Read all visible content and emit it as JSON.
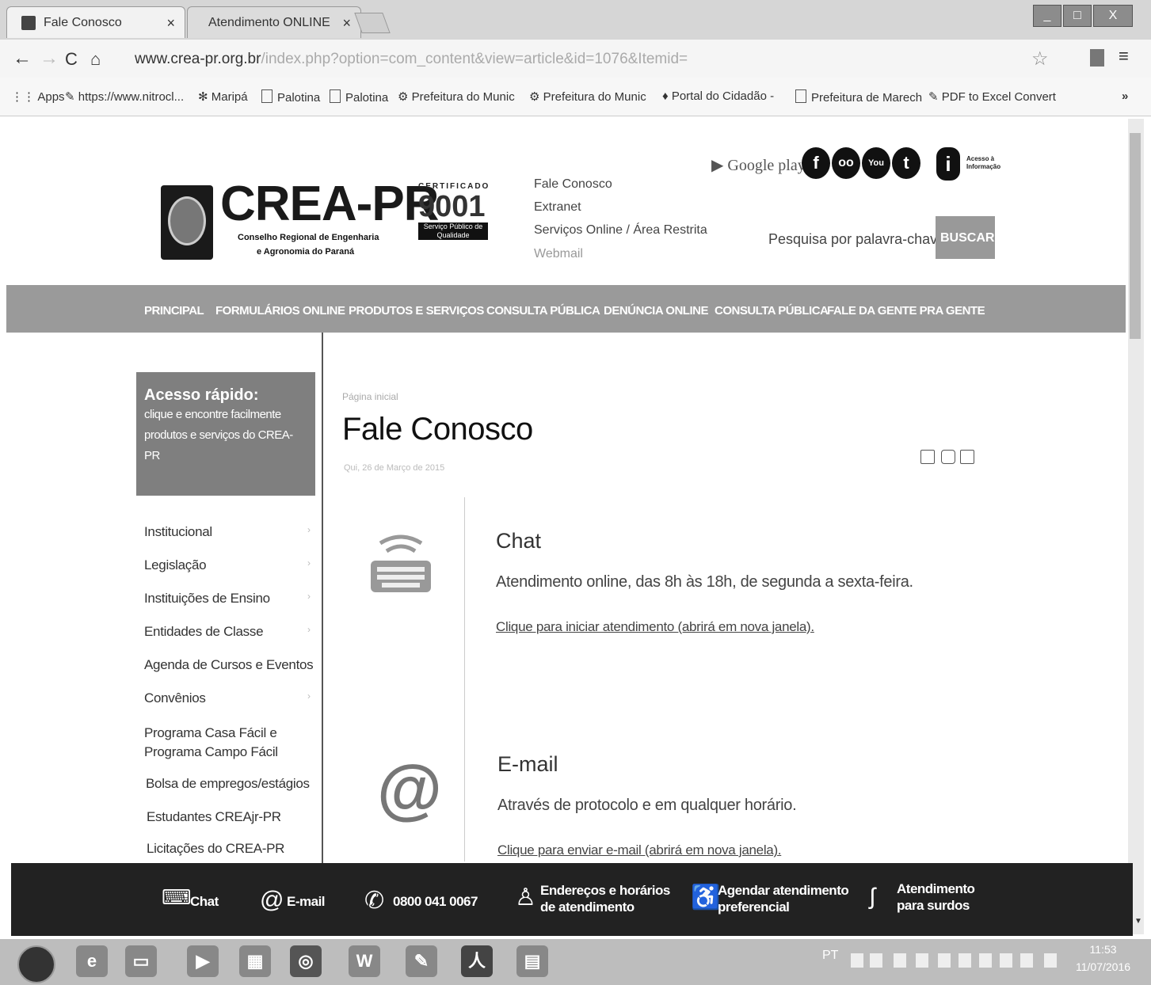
{
  "browser": {
    "tabs": [
      {
        "label": "Fale Conosco",
        "close": "×"
      },
      {
        "label": "Atendimento ONLINE",
        "close": "×"
      }
    ],
    "window_buttons": [
      "_",
      "□",
      "X"
    ],
    "url_host": "www.crea-pr.org.br",
    "url_rest": "/index.php?option=com_content&view=article&id=1076&Itemid=",
    "bookmarks": [
      "Apps",
      "https://www.nitrocl...",
      "Maripá",
      "Palotina",
      "Palotina",
      "Prefeitura do Munic",
      "Prefeitura do Munic",
      "Portal do Cidadão - ",
      "Prefeitura de Marech",
      "PDF to Excel Convert"
    ],
    "bookmarks_more": "»"
  },
  "header": {
    "logo_text": "CREA-PR",
    "logo_sub1": "Conselho Regional de Engenharia",
    "logo_sub2": "e Agronomia do Paraná",
    "iso_cert": "CERTIFICADO",
    "iso_num": "9001",
    "iso_band": "Serviço Público de Qualidade",
    "top_links": [
      "Fale Conosco",
      "Extranet",
      "Serviços Online / Área Restrita",
      "Webmail"
    ],
    "google_play": "Google play",
    "social": [
      "f",
      "oo",
      "You",
      "t"
    ],
    "info_icon": "i",
    "info_text1": "Acesso à",
    "info_text2": "Informação",
    "search_label": "Pesquisa por palavra-chave",
    "search_button": "BUSCAR"
  },
  "nav": {
    "items": [
      "PRINCIPAL",
      "FORMULÁRIOS ONLINE",
      "PRODUTOS E SERVIÇOS",
      "CONSULTA PÚBLICA",
      "DENÚNCIA ONLINE",
      "CONSULTA PÚBLICA",
      "FALE DA GENTE PRA GENTE"
    ]
  },
  "sidebar": {
    "quick_title": "Acesso rápido:",
    "quick_sub": "clique e encontre facilmente produtos e serviços do CREA-PR",
    "items": [
      {
        "label": "Institucional",
        "arrow": "›"
      },
      {
        "label": "Legislação",
        "arrow": "›"
      },
      {
        "label": "Instituições de Ensino",
        "arrow": "›"
      },
      {
        "label": "Entidades de Classe",
        "arrow": "›"
      },
      {
        "label": "Agenda de Cursos e Eventos",
        "arrow": ""
      },
      {
        "label": "Convênios",
        "arrow": "›"
      },
      {
        "label": "Programa Casa Fácil e",
        "label2": "Programa Campo Fácil",
        "arrow": ""
      },
      {
        "label": "Bolsa de empregos/estágios",
        "arrow": ""
      },
      {
        "label": "Estudantes CREAjr-PR",
        "arrow": ""
      },
      {
        "label": "Licitações do CREA-PR",
        "arrow": ""
      }
    ]
  },
  "main": {
    "breadcrumb": "Página inicial",
    "title": "Fale Conosco",
    "date": "Qui, 26 de Março de 2015",
    "chat": {
      "title": "Chat",
      "text": "Atendimento online, das 8h às 18h, de segunda a sexta-feira.",
      "link": "Clique para iniciar atendimento (abrirá em nova janela)."
    },
    "email": {
      "icon": "@",
      "title": "E-mail",
      "text": "Através de protocolo e em qualquer horário.",
      "link": "Clique para enviar e-mail (abrirá em nova janela)."
    }
  },
  "footer": {
    "chat": "Chat",
    "email": "E-mail",
    "phone": "0800 041 0067",
    "address1": "Endereços e horários",
    "address2": "de atendimento",
    "schedule1": "Agendar atendimento",
    "schedule2": "preferencial",
    "deaf1": "Atendimento",
    "deaf2": "para surdos"
  },
  "taskbar": {
    "lang": "PT",
    "time": "11:53",
    "date": "11/07/2016"
  }
}
